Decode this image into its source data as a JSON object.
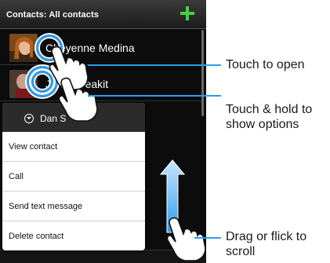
{
  "header": {
    "title": "Contacts: All contacts",
    "add_icon": "plus-icon",
    "add_color": "#3fd43f"
  },
  "contacts": [
    {
      "name": "Cheyenne Medina"
    },
    {
      "name": "Jamie Peakit"
    }
  ],
  "context_menu": {
    "header_label": "Dan S",
    "items": [
      "View contact",
      "Call",
      "Send text message",
      "Delete contact"
    ]
  },
  "callouts": {
    "touch_open": "Touch to open",
    "hold_line1": "Touch & hold to",
    "hold_line2": "show options",
    "scroll_line1": "Drag or flick to",
    "scroll_line2": "scroll"
  },
  "colors": {
    "accent": "#2a9df0",
    "background": "#0c0c0c"
  }
}
